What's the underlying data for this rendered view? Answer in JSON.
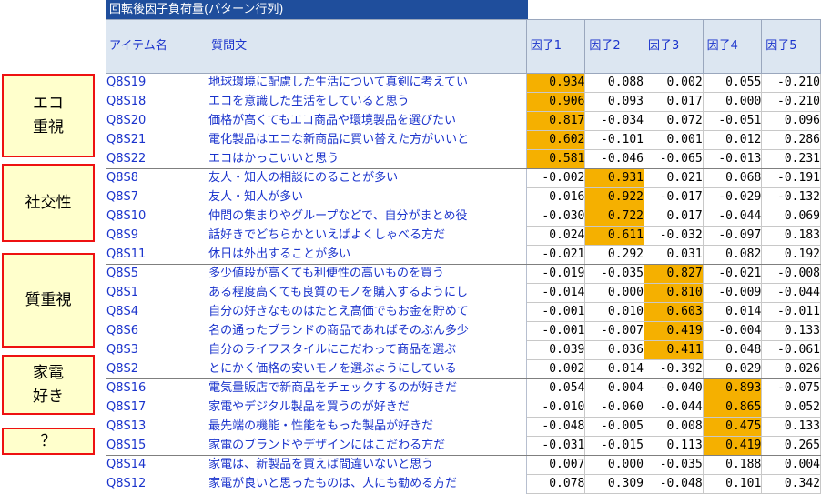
{
  "title": "回転後因子負荷量(パターン行列)",
  "headers": {
    "item": "アイテム名",
    "question": "質問文",
    "factors": [
      "因子1",
      "因子2",
      "因子3",
      "因子4",
      "因子5"
    ]
  },
  "groups": [
    {
      "label": "エコ\n重視"
    },
    {
      "label": "社交性"
    },
    {
      "label": "質重視"
    },
    {
      "label": "家電\n好き"
    },
    {
      "label": "？"
    }
  ],
  "highlight_color": "#f5b000",
  "rows": [
    {
      "item": "Q8S19",
      "question": "地球環境に配慮した生活について真剣に考えてい",
      "values": [
        "0.934",
        "0.088",
        "0.002",
        "0.055",
        "-0.210"
      ],
      "hl": 0
    },
    {
      "item": "Q8S18",
      "question": "エコを意識した生活をしていると思う",
      "values": [
        "0.906",
        "0.093",
        "0.017",
        "0.000",
        "-0.210"
      ],
      "hl": 0
    },
    {
      "item": "Q8S20",
      "question": "価格が高くてもエコ商品や環境製品を選びたい",
      "values": [
        "0.817",
        "-0.034",
        "0.072",
        "-0.051",
        "0.096"
      ],
      "hl": 0
    },
    {
      "item": "Q8S21",
      "question": "電化製品はエコな新商品に買い替えた方がいいと",
      "values": [
        "0.602",
        "-0.101",
        "0.001",
        "0.012",
        "0.286"
      ],
      "hl": 0
    },
    {
      "item": "Q8S22",
      "question": "エコはかっこいいと思う",
      "values": [
        "0.581",
        "-0.046",
        "-0.065",
        "-0.013",
        "0.231"
      ],
      "hl": 0
    },
    {
      "item": "Q8S8",
      "question": "友人・知人の相談にのることが多い",
      "values": [
        "-0.002",
        "0.931",
        "0.021",
        "0.068",
        "-0.191"
      ],
      "hl": 1
    },
    {
      "item": "Q8S7",
      "question": "友人・知人が多い",
      "values": [
        "0.016",
        "0.922",
        "-0.017",
        "-0.029",
        "-0.132"
      ],
      "hl": 1
    },
    {
      "item": "Q8S10",
      "question": "仲間の集まりやグループなどで、自分がまとめ役",
      "values": [
        "-0.030",
        "0.722",
        "0.017",
        "-0.044",
        "0.069"
      ],
      "hl": 1
    },
    {
      "item": "Q8S9",
      "question": "話好きでどちらかといえばよくしゃべる方だ",
      "values": [
        "0.024",
        "0.611",
        "-0.032",
        "-0.097",
        "0.183"
      ],
      "hl": 1
    },
    {
      "item": "Q8S11",
      "question": "休日は外出することが多い",
      "values": [
        "-0.021",
        "0.292",
        "0.031",
        "0.082",
        "0.192"
      ],
      "hl": -1
    },
    {
      "item": "Q8S5",
      "question": "多少値段が高くても利便性の高いものを買う",
      "values": [
        "-0.019",
        "-0.035",
        "0.827",
        "-0.021",
        "-0.008"
      ],
      "hl": 2
    },
    {
      "item": "Q8S1",
      "question": "ある程度高くても良質のモノを購入するようにし",
      "values": [
        "-0.014",
        "0.000",
        "0.810",
        "-0.009",
        "-0.044"
      ],
      "hl": 2
    },
    {
      "item": "Q8S4",
      "question": "自分の好きなものはたとえ高価でもお金を貯めて",
      "values": [
        "-0.001",
        "0.010",
        "0.603",
        "0.014",
        "-0.011"
      ],
      "hl": 2
    },
    {
      "item": "Q8S6",
      "question": "名の通ったブランドの商品であればそのぶん多少",
      "values": [
        "-0.001",
        "-0.007",
        "0.419",
        "-0.004",
        "0.133"
      ],
      "hl": 2
    },
    {
      "item": "Q8S3",
      "question": "自分のライフスタイルにこだわって商品を選ぶ",
      "values": [
        "0.039",
        "0.036",
        "0.411",
        "0.048",
        "-0.061"
      ],
      "hl": 2
    },
    {
      "item": "Q8S2",
      "question": "とにかく価格の安いモノを選ぶようにしている",
      "values": [
        "0.002",
        "0.014",
        "-0.392",
        "0.029",
        "0.026"
      ],
      "hl": -1
    },
    {
      "item": "Q8S16",
      "question": "電気量販店で新商品をチェックするのが好きだ",
      "values": [
        "0.054",
        "0.004",
        "-0.040",
        "0.893",
        "-0.075"
      ],
      "hl": 3
    },
    {
      "item": "Q8S17",
      "question": "家電やデジタル製品を買うのが好きだ",
      "values": [
        "-0.010",
        "-0.060",
        "-0.044",
        "0.865",
        "0.052"
      ],
      "hl": 3
    },
    {
      "item": "Q8S13",
      "question": "最先端の機能・性能をもった製品が好きだ",
      "values": [
        "-0.048",
        "-0.005",
        "0.008",
        "0.475",
        "0.133"
      ],
      "hl": 3
    },
    {
      "item": "Q8S15",
      "question": "家電のブランドやデザインにはこだわる方だ",
      "values": [
        "-0.031",
        "-0.015",
        "0.113",
        "0.419",
        "0.265"
      ],
      "hl": 3
    },
    {
      "item": "Q8S14",
      "question": "家電は、新製品を買えば間違いないと思う",
      "values": [
        "0.007",
        "0.000",
        "-0.035",
        "0.188",
        "0.004"
      ],
      "hl": -1
    },
    {
      "item": "Q8S12",
      "question": "家電が良いと思ったものは、人にも勧める方だ",
      "values": [
        "0.078",
        "0.309",
        "-0.048",
        "0.101",
        "0.342"
      ],
      "hl": -1
    }
  ]
}
